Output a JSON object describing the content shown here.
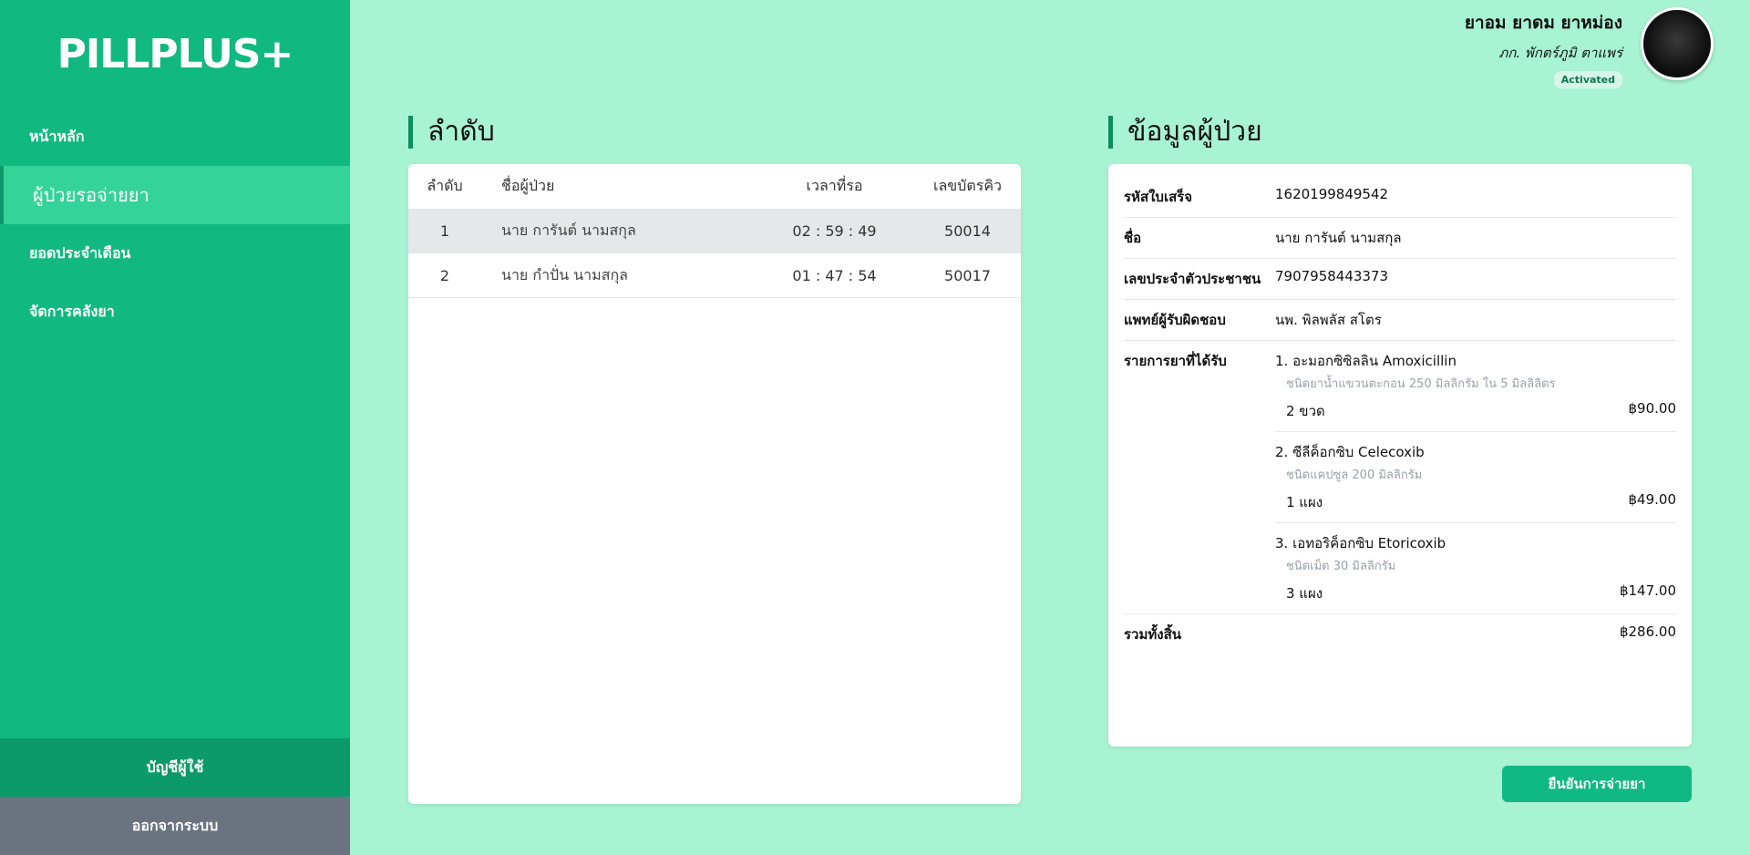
{
  "brand": {
    "logo": "PILLPLUS+"
  },
  "sidebar": {
    "items": [
      {
        "label": "หน้าหลัก"
      },
      {
        "label": "ผู้ป่วยรอจ่ายยา"
      },
      {
        "label": "ยอดประจำเดือน"
      },
      {
        "label": "จัดการคลังยา"
      }
    ],
    "account_label": "บัญชีผู้ใช้",
    "logout_label": "ออกจากระบบ"
  },
  "user": {
    "name": "ยาอม ยาดม ยาหม่อง",
    "title": "ภก. พักตร์ภูมิ ตาแพร่",
    "status": "Activated"
  },
  "queue": {
    "title": "ลำดับ",
    "headers": [
      "ลำดับ",
      "ชื่อผู้ป่วย",
      "เวลาที่รอ",
      "เลขบัตรคิว"
    ],
    "rows": [
      {
        "no": "1",
        "name": "นาย การันต์ นามสกุล",
        "wait": "02 : 59 : 49",
        "ticket": "50014"
      },
      {
        "no": "2",
        "name": "นาย กำปั่น นามสกุล",
        "wait": "01 : 47 : 54",
        "ticket": "50017"
      }
    ]
  },
  "patient": {
    "title": "ข้อมูลผู้ป่วย",
    "fields": [
      {
        "label": "รหัสใบเสร็จ",
        "value": "1620199849542"
      },
      {
        "label": "ชื่อ",
        "value": "นาย การันต์ นามสกุล"
      },
      {
        "label": "เลขประจำตัวประชาชน",
        "value": "7907958443373"
      },
      {
        "label": "แพทย์ผู้รับผิดชอบ",
        "value": "นพ. พิลพลัส สโตร"
      }
    ],
    "meds_label": "รายการยาที่ได้รับ",
    "meds": [
      {
        "name": "1. อะมอกซิซิลลิน Amoxicillin",
        "desc": "ชนิดยาน้ำแขวนตะกอน 250 มิลลิกรัม ใน 5 มิลลิลิตร",
        "qty": "2 ขวด",
        "price": "฿90.00"
      },
      {
        "name": "2. ซีลีค็อกซิบ Celecoxib",
        "desc": "ชนิดแคปซูล 200 มิลลิกรัม",
        "qty": "1 แผง",
        "price": "฿49.00"
      },
      {
        "name": "3. เอทอริค็อกซิบ Etoricoxib",
        "desc": "ชนิดเม็ด 30 มิลลิกรัม",
        "qty": "3 แผง",
        "price": "฿147.00"
      }
    ],
    "total_label": "รวมทั้งสิ้น",
    "total_value": "฿286.00"
  },
  "actions": {
    "confirm_label": "ยืนยันการจ่ายยา"
  }
}
